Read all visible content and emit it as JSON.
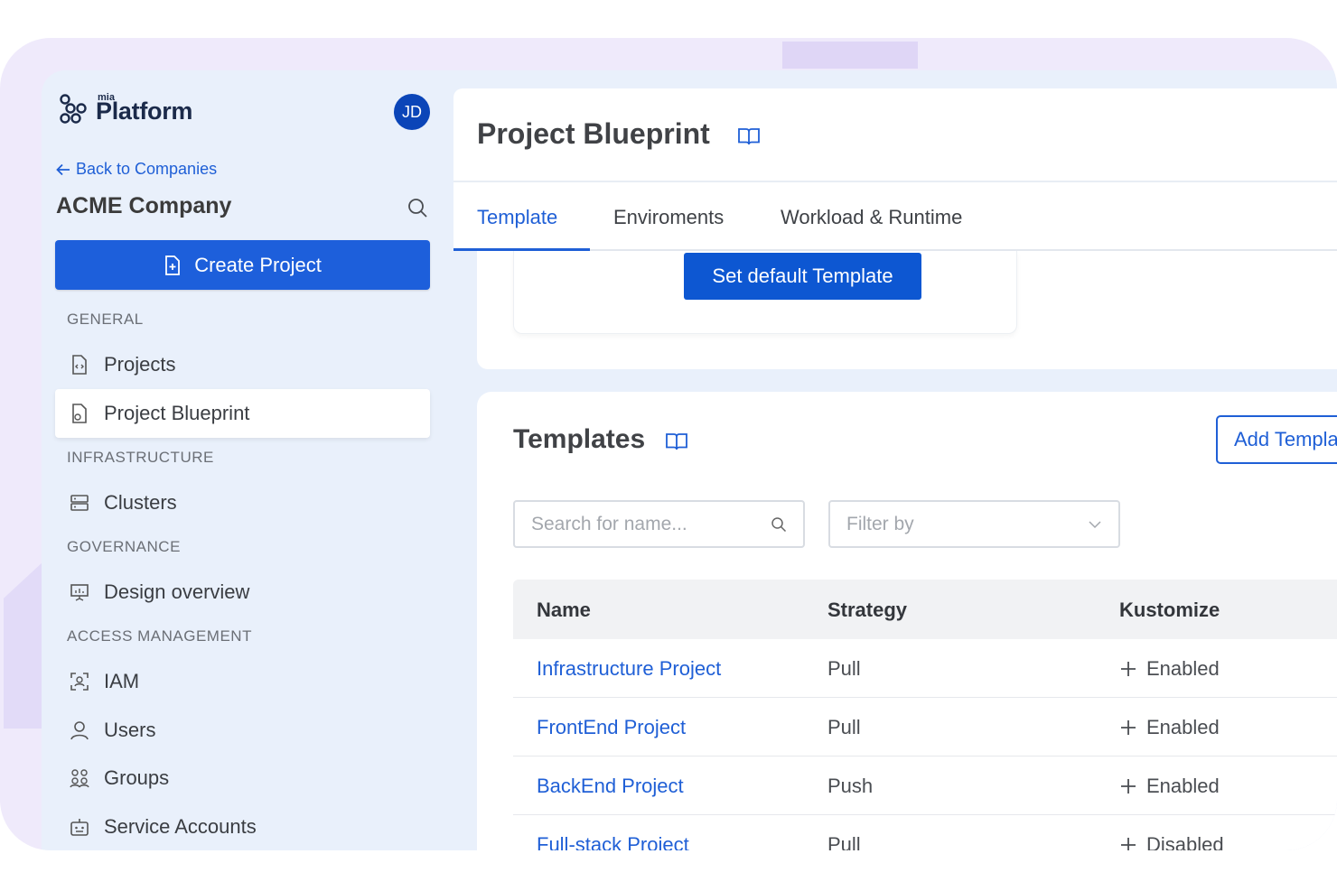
{
  "brand": {
    "small": "mia",
    "big": "Platform"
  },
  "user": {
    "initials": "JD"
  },
  "sidebar": {
    "back_label": "Back to Companies",
    "company": "ACME Company",
    "create_label": "Create Project",
    "sections": {
      "general": "GENERAL",
      "infrastructure": "INFRASTRUCTURE",
      "governance": "GOVERNANCE",
      "access": "ACCESS MANAGEMENT"
    },
    "items": {
      "projects": "Projects",
      "blueprint": "Project Blueprint",
      "clusters": "Clusters",
      "design": "Design overview",
      "iam": "IAM",
      "users": "Users",
      "groups": "Groups",
      "service_accounts": "Service Accounts"
    }
  },
  "header": {
    "title": "Project Blueprint",
    "tabs": [
      "Template",
      "Enviroments",
      "Workload & Runtime"
    ]
  },
  "default_section": {
    "button": "Set default Template"
  },
  "templates": {
    "title": "Templates",
    "add_button": "Add Template",
    "search_placeholder": "Search for name...",
    "filter_placeholder": "Filter by",
    "columns": [
      "Name",
      "Strategy",
      "Kustomize"
    ],
    "rows": [
      {
        "name": "Infrastructure Project",
        "strategy": "Pull",
        "kustomize": "Enabled"
      },
      {
        "name": "FrontEnd Project",
        "strategy": "Pull",
        "kustomize": "Enabled"
      },
      {
        "name": "BackEnd Project",
        "strategy": "Push",
        "kustomize": "Enabled"
      },
      {
        "name": "Full-stack Project",
        "strategy": "Pull",
        "kustomize": "Disabled"
      }
    ]
  },
  "colors": {
    "primary": "#1d5fdb",
    "link": "#1f5fd6",
    "avatar": "#0b45b8",
    "frame": "#efeafb",
    "sidebar_bg": "#e9f0fb"
  }
}
